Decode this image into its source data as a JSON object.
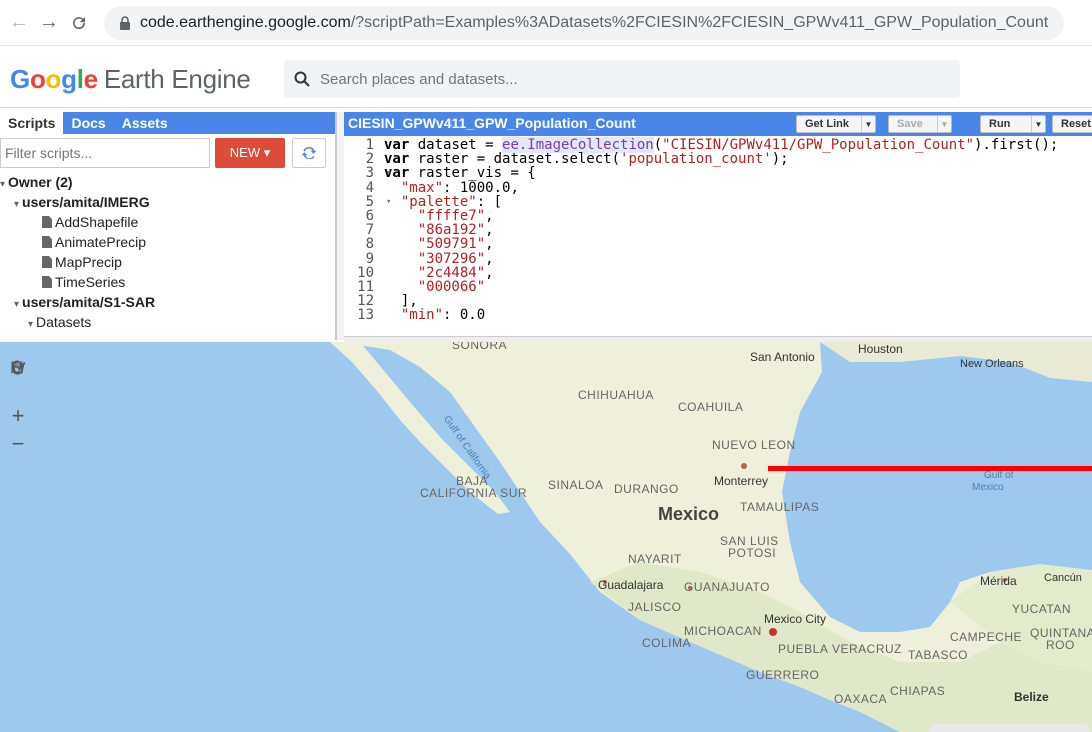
{
  "browser": {
    "url_host": "code.earthengine.google.com",
    "url_path": "/?scriptPath=Examples%3ADatasets%2FCIESIN%2FCIESIN_GPWv411_GPW_Population_Count"
  },
  "header": {
    "logo_word": "Google",
    "logo_rest": "Earth Engine",
    "search_placeholder": "Search places and datasets..."
  },
  "left_panel": {
    "tabs": [
      "Scripts",
      "Docs",
      "Assets"
    ],
    "filter_placeholder": "Filter scripts...",
    "new_label": "NEW ▾",
    "tree": [
      {
        "label": "Owner (2)",
        "bold": true
      },
      {
        "label": "users/amita/IMERG",
        "bold": true
      },
      {
        "label": "AddShapefile"
      },
      {
        "label": "AnimatePrecip"
      },
      {
        "label": "MapPrecip"
      },
      {
        "label": "TimeSeries"
      },
      {
        "label": "users/amita/S1-SAR",
        "bold": true
      },
      {
        "label": "Datasets"
      }
    ]
  },
  "editor": {
    "title": "CIESIN_GPWv411_GPW_Population_Count",
    "buttons": {
      "get_link": "Get Link",
      "save": "Save",
      "run": "Run",
      "reset": "Reset"
    },
    "line_numbers": [
      "1",
      "2",
      "3",
      "4",
      "5",
      "6",
      "7",
      "8",
      "9",
      "10",
      "11",
      "12",
      "13"
    ]
  },
  "map": {
    "country": "Mexico",
    "labels": {
      "sonora": "SONORA",
      "chihuahua": "CHIHUAHUA",
      "coahuila": "COAHUILA",
      "nuevo_leon": "NUEVO LEON",
      "gulf_california": "Gulf of California",
      "baja": "BAJA",
      "california_sur": "CALIFORNIA SUR",
      "sinaloa": "SINALOA",
      "durango": "DURANGO",
      "monterrey": "Monterrey",
      "tamaulipas": "TAMAULIPAS",
      "san_luis": "SAN LUIS",
      "potosi": "POTOSI",
      "nayarit": "NAYARIT",
      "guadalajara": "Guadalajara",
      "guanajuato": "GUANAJUATO",
      "jalisco": "JALISCO",
      "mexico_city": "Mexico City",
      "michoacan": "MICHOACAN",
      "colima": "COLIMA",
      "puebla": "PUEBLA",
      "veracruz": "VERACRUZ",
      "guerrero": "GUERRERO",
      "oaxaca": "OAXACA",
      "chiapas": "CHIAPAS",
      "tabasco": "TABASCO",
      "campeche": "CAMPECHE",
      "yucatan": "YUCATAN",
      "quintana": "QUINTANA",
      "roo": "ROO",
      "merida": "Mérida",
      "cancun": "Cancún",
      "belize": "Belize",
      "san_antonio": "San Antonio",
      "houston": "Houston",
      "new_orleans": "New Orleans",
      "gulf_of": "Gulf of",
      "mexico_water": "Mexico"
    },
    "zoom_in": "+",
    "zoom_out": "−"
  }
}
